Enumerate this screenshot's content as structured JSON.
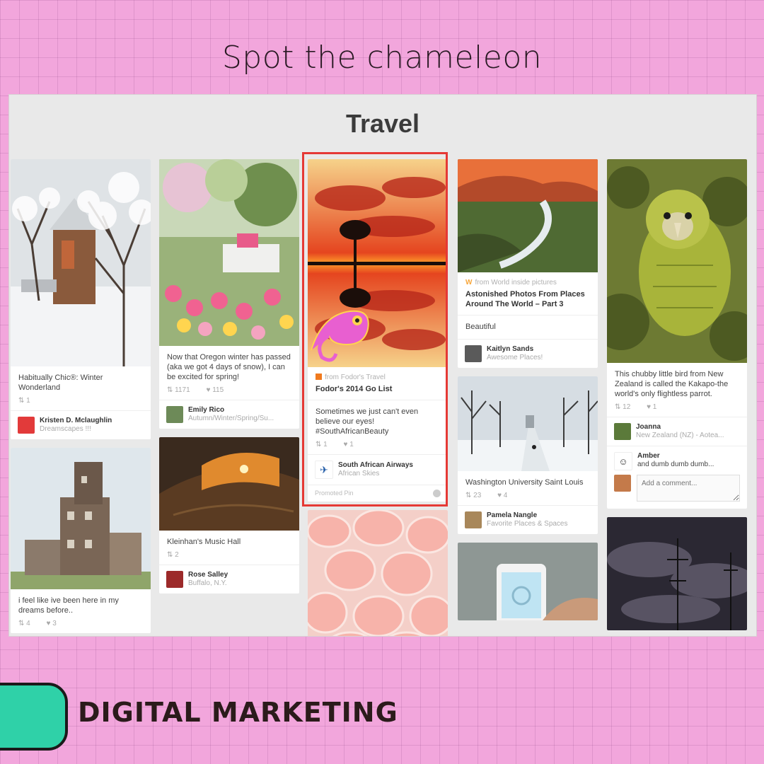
{
  "headline": "Spot the chameleon",
  "board_title": "Travel",
  "footer_brand": "DIGITAL MARKETING",
  "columns": [
    {
      "pins": [
        {
          "image": "snowy-house",
          "description": "Habitually Chic®: Winter Wonderland",
          "repins": "1",
          "likes": "",
          "user": "Kristen D. Mclaughlin",
          "board": "Dreamscapes !!!"
        },
        {
          "image": "stacked-house",
          "description": "i feel like ive been here in my dreams before..",
          "repins": "4",
          "likes": "3"
        }
      ]
    },
    {
      "pins": [
        {
          "image": "garden-flowers",
          "description": "Now that Oregon winter has passed (aka we got 4 days of snow), I can be excited for spring!",
          "repins": "1171",
          "likes": "115",
          "user": "Emily Rico",
          "board": "Autumn/Winter/Spring/Su..."
        },
        {
          "image": "music-hall",
          "description": "Kleinhan's Music Hall",
          "repins": "2",
          "likes": "",
          "user": "Rose Salley",
          "board": "Buffalo, N.Y."
        }
      ]
    },
    {
      "pins": [
        {
          "image": "sunset-reflection",
          "from": "from Fodor's Travel",
          "title": "Fodor's 2014 Go List",
          "description": "Sometimes we just can't even believe our eyes! #SouthAfricanBeauty",
          "repins": "1",
          "likes": "1",
          "user": "South African Airways",
          "board": "African Skies",
          "promoted": "Promoted Pin"
        },
        {
          "image": "seashells"
        }
      ]
    },
    {
      "pins": [
        {
          "image": "waterfall",
          "from": "from World inside pictures",
          "title": "Astonished Photos From Places Around The World – Part 3",
          "note": "Beautiful",
          "user": "Kaitlyn Sands",
          "board": "Awesome Places!"
        },
        {
          "image": "snowy-campus",
          "description": "Washington University Saint Louis",
          "repins": "23",
          "likes": "4",
          "user": "Pamela Nangle",
          "board": "Favorite Places & Spaces"
        },
        {
          "image": "phone-hand"
        }
      ]
    },
    {
      "pins": [
        {
          "image": "kakapo-parrot",
          "description": "This chubby little bird from New Zealand is called the Kakapo-the world's only flightless parrot.",
          "repins": "12",
          "likes": "1",
          "user": "Joanna",
          "board": "New Zealand (NZ) - Aotea...",
          "commenter": "Amber",
          "comment": "and dumb dumb dumb...",
          "comment_placeholder": "Add a comment..."
        },
        {
          "image": "stormy-ship"
        }
      ]
    }
  ],
  "colors": {
    "background": "#f2a6dc",
    "highlight": "#e53935",
    "pill": "#2fd1a8",
    "brand_text": "#2b1b1b"
  }
}
